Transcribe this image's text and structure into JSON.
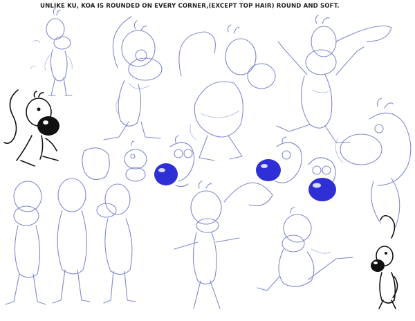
{
  "caption": "UNLIKE KU, KOA IS ROUNDED ON EVERY CORNER,(EXCEPT TOP HAIR) ROUND AND SOFT.",
  "colors": {
    "background": "#ffffff",
    "sketch_line": "#6a74c9",
    "ink_line": "#111111",
    "nose_blue": "#2f2fd6"
  }
}
